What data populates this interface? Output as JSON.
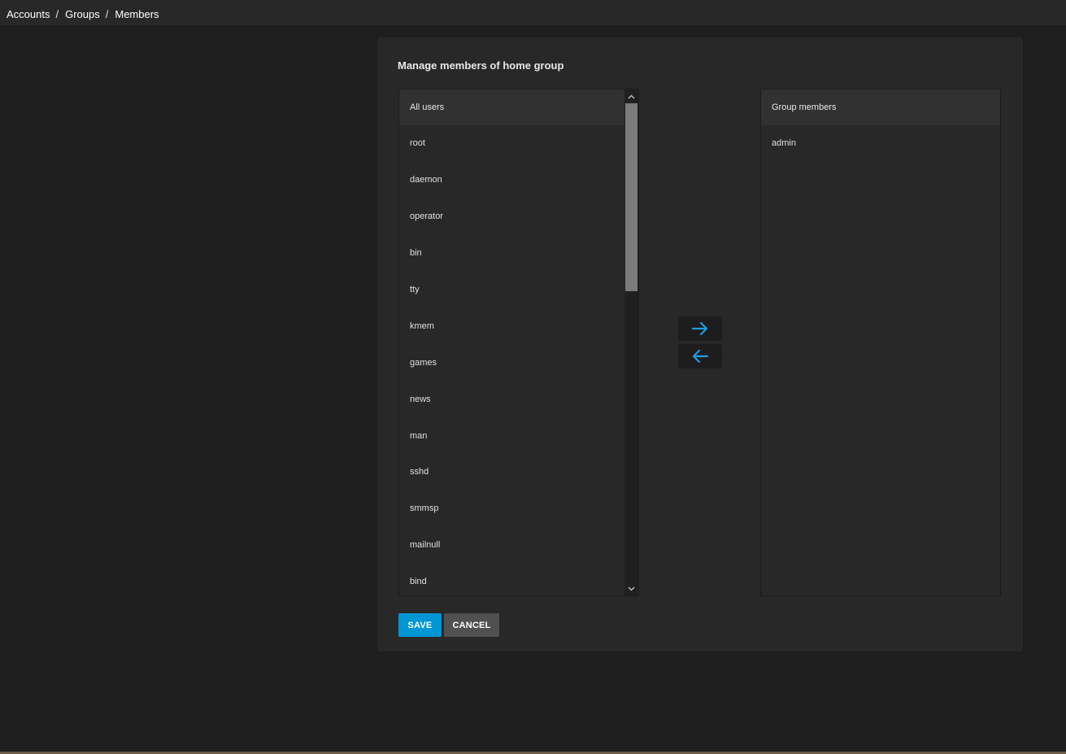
{
  "breadcrumb": {
    "items": [
      "Accounts",
      "Groups",
      "Members"
    ],
    "separator": "/"
  },
  "card": {
    "title": "Manage members of home group"
  },
  "all_users": {
    "header": "All users",
    "items": [
      "root",
      "daemon",
      "operator",
      "bin",
      "tty",
      "kmem",
      "games",
      "news",
      "man",
      "sshd",
      "smmsp",
      "mailnull",
      "bind"
    ]
  },
  "group_members": {
    "header": "Group members",
    "items": [
      "admin"
    ]
  },
  "actions": {
    "save_label": "SAVE",
    "cancel_label": "CANCEL"
  },
  "colors": {
    "accent": "#0095d5",
    "arrow": "#1e9be0"
  }
}
